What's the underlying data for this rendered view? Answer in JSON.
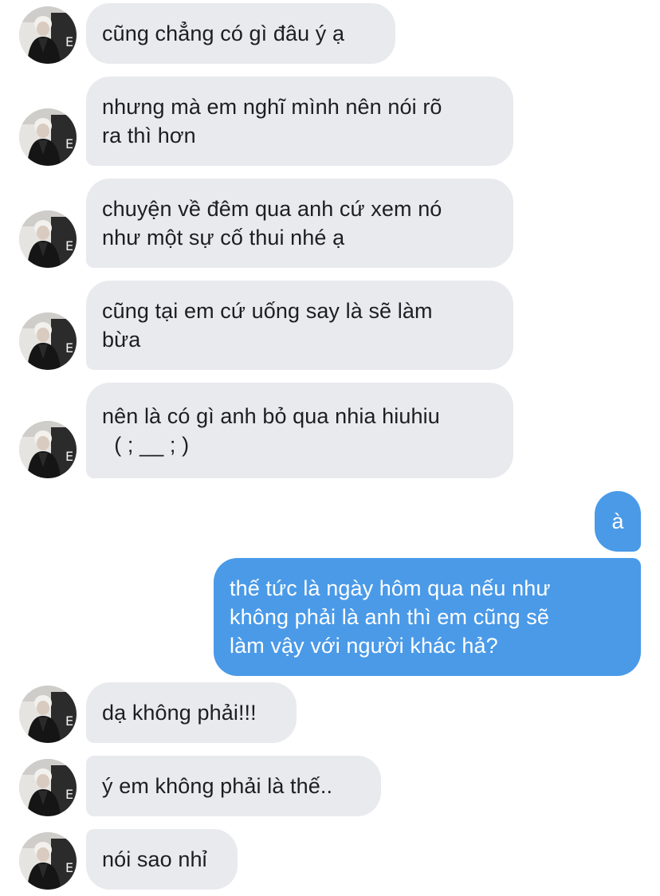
{
  "conversation": {
    "incoming_group_1": [
      "cũng chẳng có gì đâu ý ạ",
      "nhưng mà em nghĩ mình nên nói rõ\nra thì hơn",
      "chuyện về đêm qua anh cứ xem nó\nnhư một sự cố thui nhé ạ",
      "cũng tại em cứ uống say là sẽ làm\nbừa",
      "nên là có gì anh bỏ qua nhia hiuhiu\n  ( ; __ ; )"
    ],
    "outgoing": [
      "à",
      "thế tức là ngày hôm qua nếu như\nkhông phải là anh thì em cũng sẽ\nlàm vậy với người khác hả?"
    ],
    "incoming_group_2": [
      "dạ không phải!!!",
      "ý em không phải là thế..",
      "nói sao nhỉ"
    ]
  },
  "colors": {
    "incoming_bubble": "#e9eaee",
    "outgoing_bubble": "#4a9ae8",
    "incoming_text": "#1c1e21",
    "outgoing_text": "#ffffff"
  },
  "icons": {
    "avatar": "contact-avatar-icon"
  }
}
